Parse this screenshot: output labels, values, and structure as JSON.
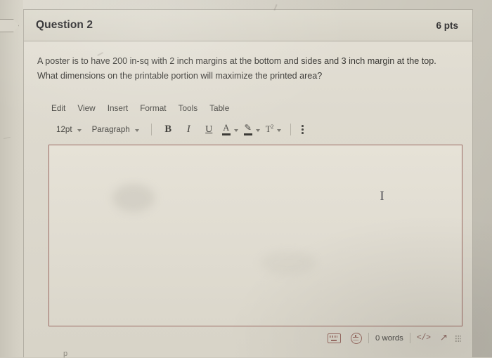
{
  "question": {
    "title": "Question 2",
    "points": "6 pts",
    "text": "A poster is to have 200 in-sq with 2 inch margins at the bottom and sides and 3 inch margin at the top.  What dimensions on the printable portion will maximize the printed area?"
  },
  "editor": {
    "menubar": [
      {
        "label": "Edit"
      },
      {
        "label": "View"
      },
      {
        "label": "Insert"
      },
      {
        "label": "Format"
      },
      {
        "label": "Tools"
      },
      {
        "label": "Table"
      }
    ],
    "toolbar": {
      "font_size": "12pt",
      "block_format": "Paragraph",
      "bold": "B",
      "italic": "I",
      "underline": "U",
      "text_color": "A",
      "highlight": "✎",
      "superscript": "T",
      "superscript_exponent": "2",
      "more_options": "⋮"
    },
    "content": "",
    "cursor_glyph": "I",
    "statusbar": {
      "keyboard_icon": "keyboard-shortcuts-icon",
      "accessibility_icon": "accessibility-checker-icon",
      "word_count": "0 words",
      "source_code": "</>",
      "fullscreen": "↗",
      "resize": "resize-handle"
    },
    "element_path": "p"
  },
  "colors": {
    "editor_border": "#9c6a63",
    "header_bg": "#d6d2c6",
    "page_bg": "#d5d1c5",
    "icon_accent": "#9b6f66",
    "text": "#3a3935"
  }
}
